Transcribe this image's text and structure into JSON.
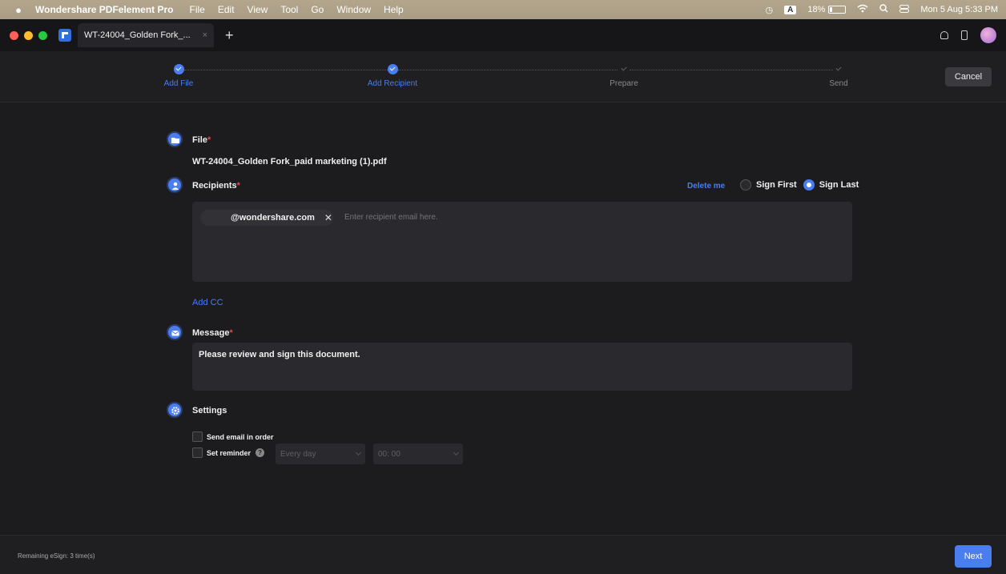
{
  "menubar": {
    "app_name": "Wondershare PDFelement Pro",
    "items": [
      "File",
      "Edit",
      "View",
      "Tool",
      "Go",
      "Window",
      "Help"
    ],
    "input_indicator": "A",
    "battery_text": "18%",
    "battery_level": 0.18,
    "datetime": "Mon 5 Aug  5:33 PM"
  },
  "tabbar": {
    "tab_title": "WT-24004_Golden Fork_...",
    "tab_close": "×",
    "new_tab": "+"
  },
  "stepper": {
    "steps": [
      {
        "label": "Add File",
        "state": "done"
      },
      {
        "label": "Add Recipient",
        "state": "done"
      },
      {
        "label": "Prepare",
        "state": "pending"
      },
      {
        "label": "Send",
        "state": "pending"
      }
    ],
    "cancel_label": "Cancel"
  },
  "file": {
    "title": "File",
    "required_mark": "*",
    "filename": "WT-24004_Golden Fork_paid marketing (1).pdf"
  },
  "recipients": {
    "title": "Recipients",
    "required_mark": "*",
    "delete_me": "Delete me",
    "sign_first": "Sign First",
    "sign_last": "Sign Last",
    "selected_order": "Sign Last",
    "chip_email": "@wondershare.com",
    "chip_remove": "✕",
    "placeholder": "Enter recipient email here.",
    "add_cc": "Add CC"
  },
  "message": {
    "title": "Message",
    "required_mark": "*",
    "text": "Please review and sign this document."
  },
  "settings": {
    "title": "Settings",
    "send_in_order": "Send email in order",
    "set_reminder": "Set reminder",
    "help_glyph": "?",
    "frequency_value": "Every day",
    "time_value": "00: 00"
  },
  "footer": {
    "remaining": "Remaining eSign: 3 time(s)",
    "next_label": "Next"
  },
  "colors": {
    "accent": "#4a7dee",
    "required": "#e5484d",
    "background": "#1c1c1e"
  }
}
